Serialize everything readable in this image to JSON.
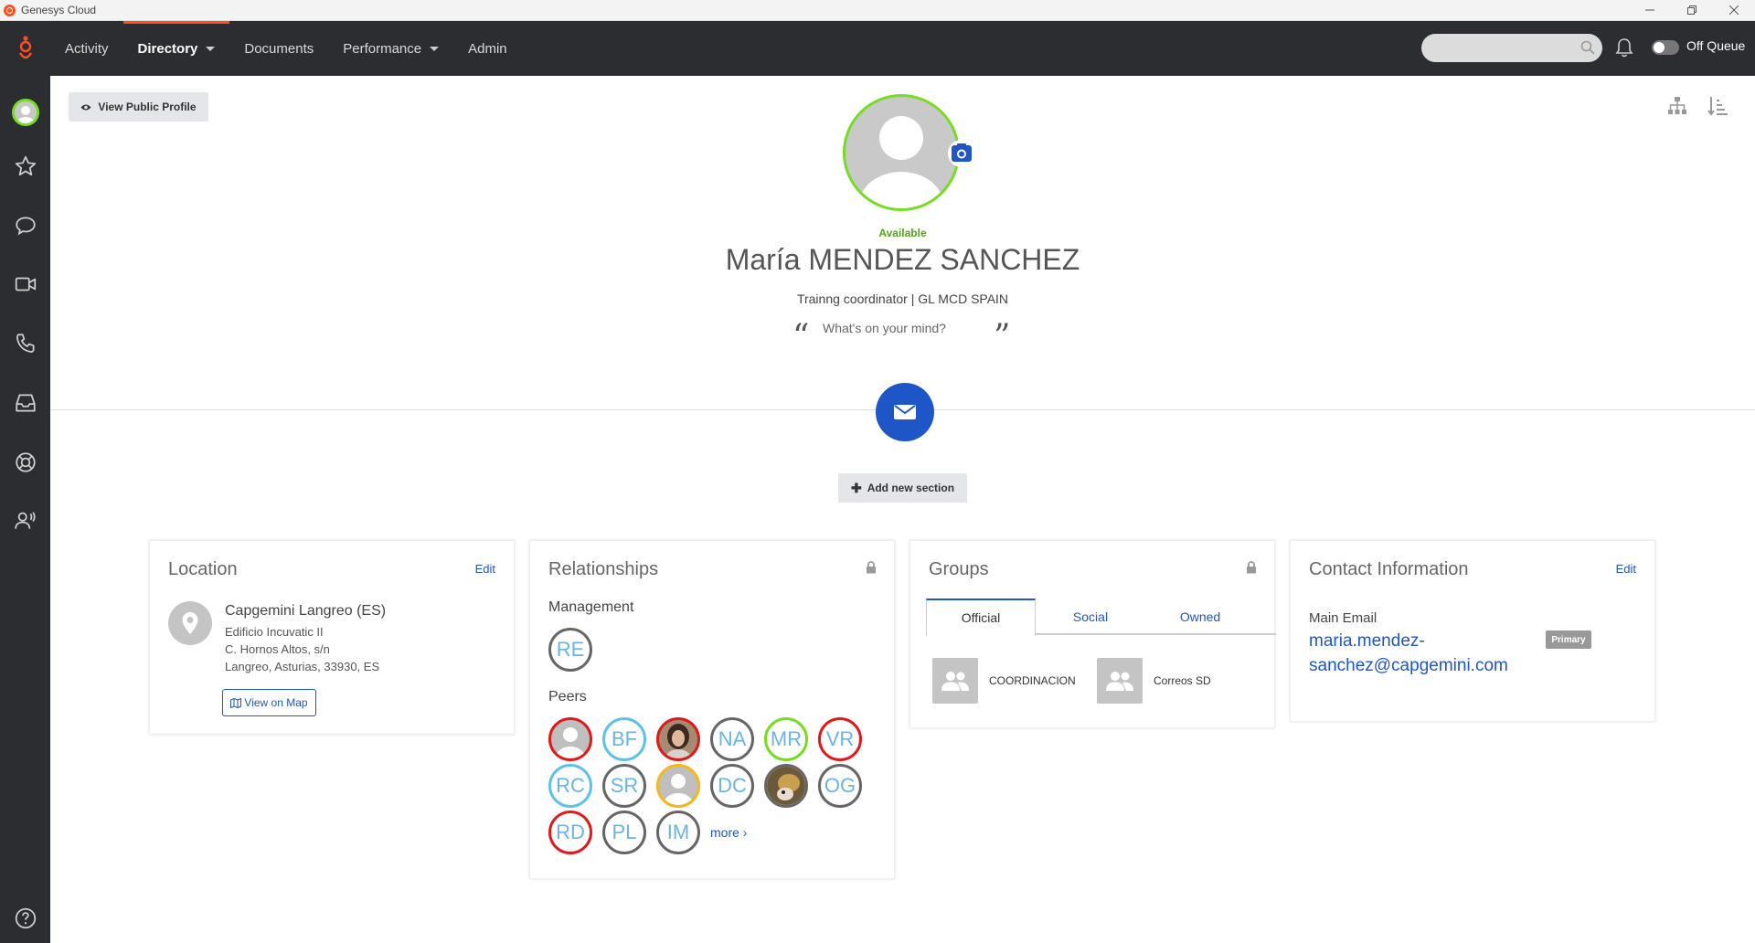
{
  "window": {
    "title": "Genesys Cloud"
  },
  "nav": {
    "items": [
      {
        "label": "Activity"
      },
      {
        "label": "Directory"
      },
      {
        "label": "Documents"
      },
      {
        "label": "Performance"
      },
      {
        "label": "Admin"
      }
    ],
    "status_label": "Off Queue"
  },
  "profile": {
    "view_public_button": "View Public Profile",
    "status": "Available",
    "name": "María MENDEZ SANCHEZ",
    "title_line": "Trainng coordinator | GL MCD SPAIN",
    "mind_placeholder": "What's on your mind?",
    "add_section_button": "Add new section"
  },
  "location": {
    "title": "Location",
    "edit": "Edit",
    "name": "Capgemini Langreo (ES)",
    "lines": [
      "Edificio Incuvatic II",
      "C. Hornos Altos, s/n",
      "Langreo, Asturias, 33930, ES"
    ],
    "map_button": "View on Map"
  },
  "relationships": {
    "title": "Relationships",
    "management_label": "Management",
    "management": [
      {
        "initials": "RE",
        "presence": "grey"
      }
    ],
    "peers_label": "Peers",
    "peers": [
      {
        "initials": "",
        "presence": "red",
        "photo": "default"
      },
      {
        "initials": "BF",
        "presence": "blue"
      },
      {
        "initials": "",
        "presence": "red",
        "photo": "person"
      },
      {
        "initials": "NA",
        "presence": "grey"
      },
      {
        "initials": "MR",
        "presence": "green"
      },
      {
        "initials": "VR",
        "presence": "red"
      },
      {
        "initials": "RC",
        "presence": "blue"
      },
      {
        "initials": "SR",
        "presence": "grey"
      },
      {
        "initials": "",
        "presence": "yellow",
        "photo": "default"
      },
      {
        "initials": "DC",
        "presence": "grey"
      },
      {
        "initials": "",
        "presence": "grey",
        "photo": "animal"
      },
      {
        "initials": "OG",
        "presence": "grey"
      },
      {
        "initials": "RD",
        "presence": "red"
      },
      {
        "initials": "PL",
        "presence": "grey"
      },
      {
        "initials": "IM",
        "presence": "grey"
      }
    ],
    "more": "more ›"
  },
  "groups": {
    "title": "Groups",
    "tabs": [
      "Official",
      "Social",
      "Owned"
    ],
    "items": [
      {
        "name": "COORDINACION"
      },
      {
        "name": "Correos SD"
      }
    ]
  },
  "contact": {
    "title": "Contact Information",
    "edit": "Edit",
    "email_label": "Main Email",
    "email": "maria.mendez-sanchez@capgemini.com",
    "badge": "Primary"
  },
  "colors": {
    "accent": "#ff4f1f",
    "link": "#1e56c8",
    "available": "#77dd22",
    "nav_bg": "#2b2d30"
  }
}
